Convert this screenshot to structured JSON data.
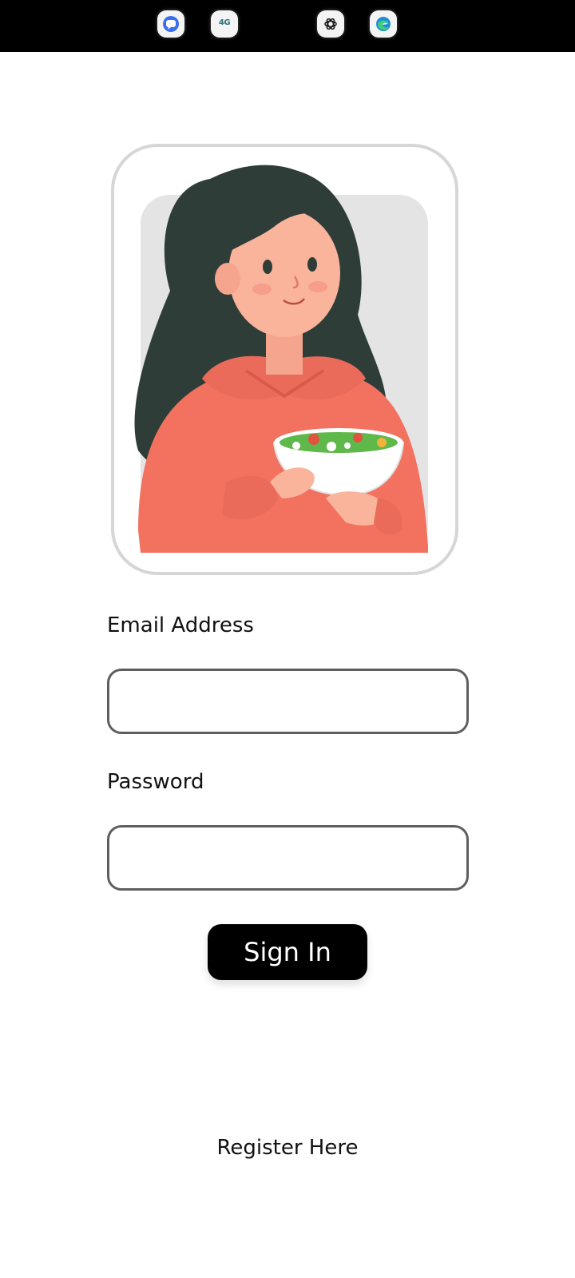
{
  "status_bar": {
    "background": "#000000",
    "icons": [
      {
        "name": "chat-bubble-icon",
        "color": "#3a6ff0"
      },
      {
        "name": "network-4g-icon",
        "text": "4G"
      },
      {
        "name": "openai-icon"
      },
      {
        "name": "edge-browser-icon",
        "color": "#1f8dd6"
      }
    ]
  },
  "login": {
    "email_label": "Email Address",
    "email_value": "",
    "password_label": "Password",
    "password_value": "",
    "signin_label": "Sign In",
    "register_label": "Register Here"
  },
  "colors": {
    "button_bg": "#000000",
    "button_text": "#ffffff",
    "input_border": "#5e5e5e",
    "frame_border": "#d6d6d6"
  }
}
